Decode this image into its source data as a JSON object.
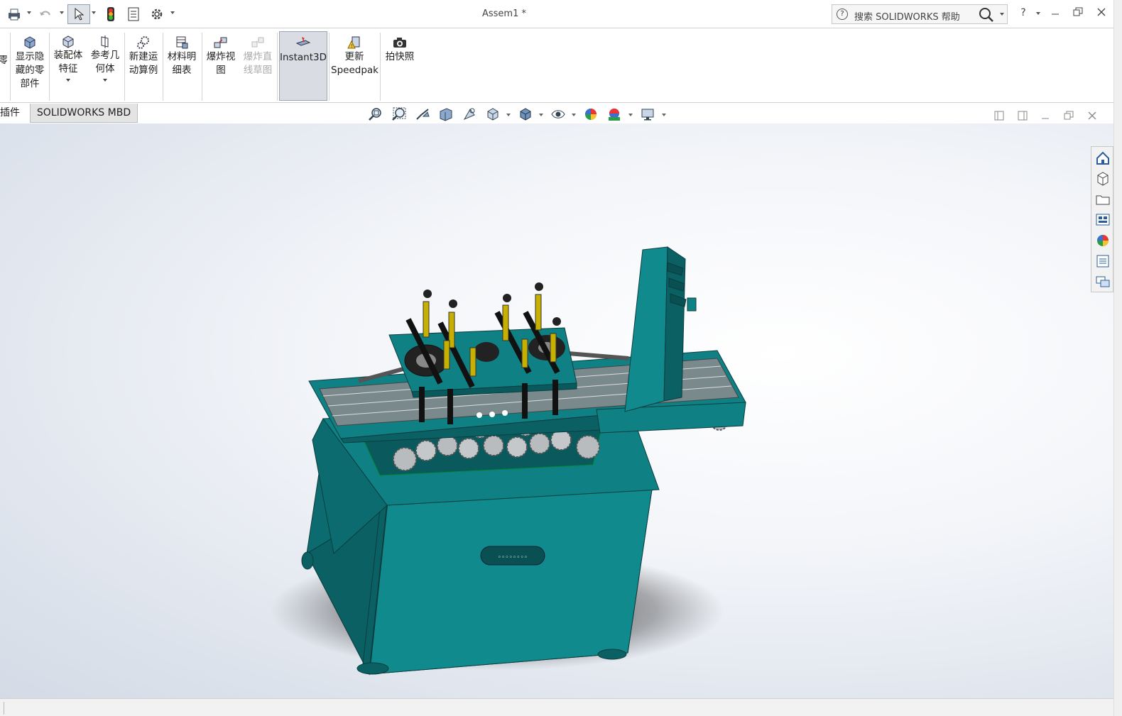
{
  "window": {
    "title": "Assem1 *"
  },
  "quick_access": [
    "print-icon",
    "undo-icon",
    "select-icon",
    "rebuild-icon",
    "file-properties-icon",
    "options-icon"
  ],
  "help_search": {
    "placeholder": "搜索 SOLIDWORKS 帮助",
    "help_label": "?"
  },
  "ribbon": {
    "items": [
      {
        "id": "partial",
        "label": "零",
        "sub": ""
      },
      {
        "id": "show-hidden",
        "label": "显示隐",
        "label2": "藏的零",
        "label3": "部件"
      },
      {
        "id": "assembly-feature",
        "label": "装配体",
        "label2": "特征"
      },
      {
        "id": "reference-geometry",
        "label": "参考几",
        "label2": "何体"
      },
      {
        "id": "new-motion-study",
        "label": "新建运",
        "label2": "动算例"
      },
      {
        "id": "bom",
        "label": "材料明",
        "label2": "细表"
      },
      {
        "id": "exploded-view",
        "label": "爆炸视",
        "label2": "图"
      },
      {
        "id": "explode-line-sketch",
        "label": "爆炸直",
        "label2": "线草图"
      },
      {
        "id": "instant3d",
        "label": "Instant3D"
      },
      {
        "id": "update-speedpak",
        "label": "更新",
        "label2": "Speedpak"
      },
      {
        "id": "take-snapshot",
        "label": "拍快照"
      }
    ]
  },
  "tabs": [
    {
      "label": "插件",
      "selected": false
    },
    {
      "label": "SOLIDWORKS MBD",
      "selected": true
    }
  ],
  "heads_up_toolbar": [
    "zoom-to-fit-icon",
    "zoom-to-area-icon",
    "previous-view-icon",
    "section-view-icon",
    "dynamic-annotation-icon",
    "view-orientation-icon",
    "display-style-icon",
    "hide-show-items-icon",
    "edit-appearance-icon",
    "apply-scene-icon",
    "view-settings-icon"
  ],
  "task_pane": [
    "home-icon",
    "design-library-icon",
    "file-explorer-icon",
    "view-palette-icon",
    "appearances-icon",
    "custom-properties-icon",
    "forum-icon"
  ],
  "colors": {
    "accent": "#0f8184",
    "accent_dark": "#0a5c5f",
    "ribbon_active": "#d9dde3"
  }
}
